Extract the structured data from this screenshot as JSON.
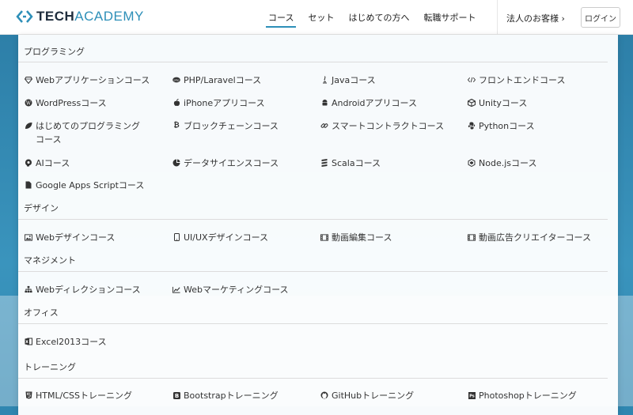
{
  "header": {
    "logo_primary": "TECH",
    "logo_accent": "ACADEMY",
    "nav": [
      {
        "label": "コース",
        "active": true
      },
      {
        "label": "セット",
        "active": false
      },
      {
        "label": "はじめての方へ",
        "active": false
      },
      {
        "label": "転職サポート",
        "active": false
      }
    ],
    "corporate": "法人のお客様 ›",
    "login": "ログイン"
  },
  "menu": {
    "sections": [
      {
        "title": "プログラミング",
        "items": [
          {
            "label": "Webアプリケーションコース",
            "icon": "diamond-icon"
          },
          {
            "label": "PHP/Laravelコース",
            "icon": "php-icon"
          },
          {
            "label": "Javaコース",
            "icon": "java-icon"
          },
          {
            "label": "フロントエンドコース",
            "icon": "code-icon"
          },
          {
            "label": "WordPressコース",
            "icon": "wordpress-icon"
          },
          {
            "label": "iPhoneアプリコース",
            "icon": "apple-icon"
          },
          {
            "label": "Androidアプリコース",
            "icon": "android-icon"
          },
          {
            "label": "Unityコース",
            "icon": "unity-icon"
          },
          {
            "label": "はじめてのプログラミングコース",
            "icon": "leaf-icon"
          },
          {
            "label": "ブロックチェーンコース",
            "icon": "bitcoin-icon"
          },
          {
            "label": "スマートコントラクトコース",
            "icon": "link-icon"
          },
          {
            "label": "Pythonコース",
            "icon": "python-icon"
          },
          {
            "label": "AIコース",
            "icon": "ai-icon"
          },
          {
            "label": "データサイエンスコース",
            "icon": "chart-pie-icon"
          },
          {
            "label": "Scalaコース",
            "icon": "scala-icon"
          },
          {
            "label": "Node.jsコース",
            "icon": "nodejs-icon"
          },
          {
            "label": "Google Apps Scriptコース",
            "icon": "file-icon"
          }
        ]
      },
      {
        "title": "デザイン",
        "items": [
          {
            "label": "Webデザインコース",
            "icon": "image-icon"
          },
          {
            "label": "UI/UXデザインコース",
            "icon": "mobile-icon"
          },
          {
            "label": "動画編集コース",
            "icon": "film-icon"
          },
          {
            "label": "動画広告クリエイターコース",
            "icon": "film-icon"
          }
        ]
      },
      {
        "title": "マネジメント",
        "items": [
          {
            "label": "Webディレクションコース",
            "icon": "sitemap-icon"
          },
          {
            "label": "Webマーケティングコース",
            "icon": "line-chart-icon"
          }
        ]
      },
      {
        "title": "オフィス",
        "items": [
          {
            "label": "Excel2013コース",
            "icon": "excel-icon"
          }
        ]
      },
      {
        "title": "トレーニング",
        "items": [
          {
            "label": "HTML/CSSトレーニング",
            "icon": "html5-icon"
          },
          {
            "label": "Bootstrapトレーニング",
            "icon": "bootstrap-icon"
          },
          {
            "label": "GitHubトレーニング",
            "icon": "github-icon"
          },
          {
            "label": "Photoshopトレーニング",
            "icon": "photoshop-icon"
          }
        ]
      }
    ]
  }
}
